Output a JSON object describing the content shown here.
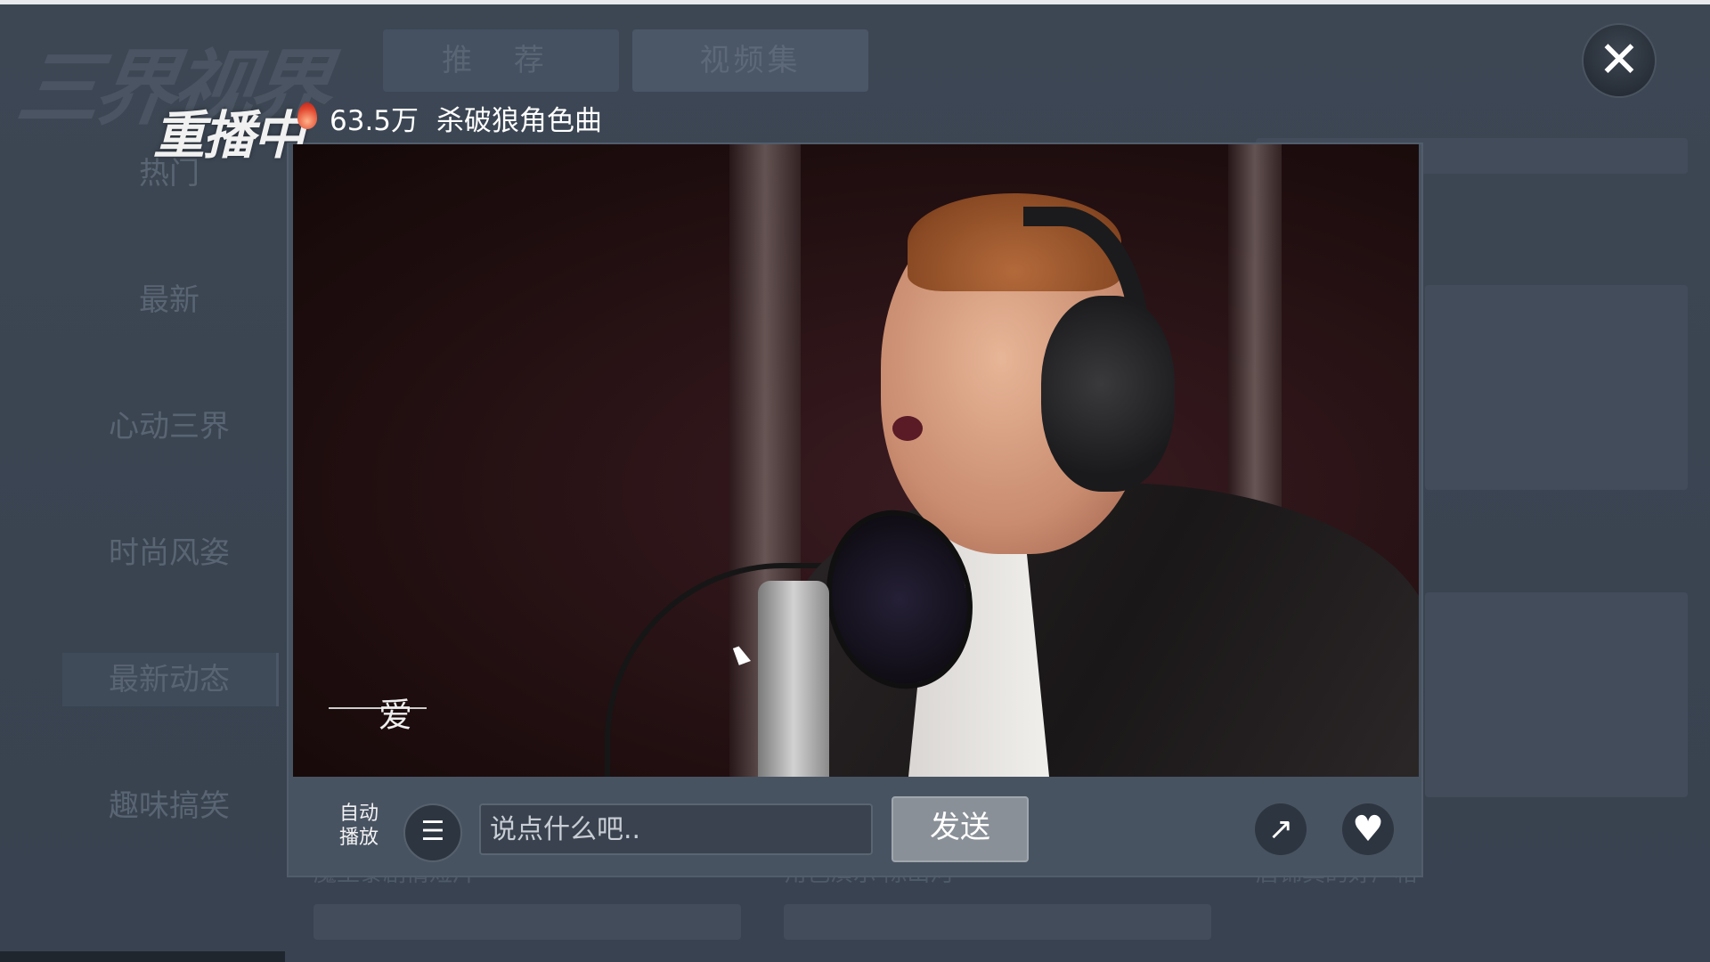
{
  "background_app": {
    "logo": "三界视界",
    "tabs": [
      "推 荐",
      "视频集"
    ],
    "sidebar": [
      "热门",
      "最新",
      "心动三界",
      "时尚风姿",
      "最新动态",
      "趣味搞笑"
    ],
    "captions": [
      "魔王泰剧情短片",
      "角色演示·陈山河",
      "唐锦真的好严格"
    ]
  },
  "player": {
    "status": "重播中",
    "views": "63.5万",
    "title": "杀破狼角色曲",
    "watermark_char": "爱",
    "controls": {
      "autoplay": "自动播放",
      "comment_placeholder": "说点什么吧..",
      "send": "发送"
    }
  },
  "icons": {
    "close": "close-icon",
    "fire": "fire-icon",
    "danmaku": "danmaku-toggle-icon",
    "share": "share-icon",
    "like": "heart-icon"
  }
}
